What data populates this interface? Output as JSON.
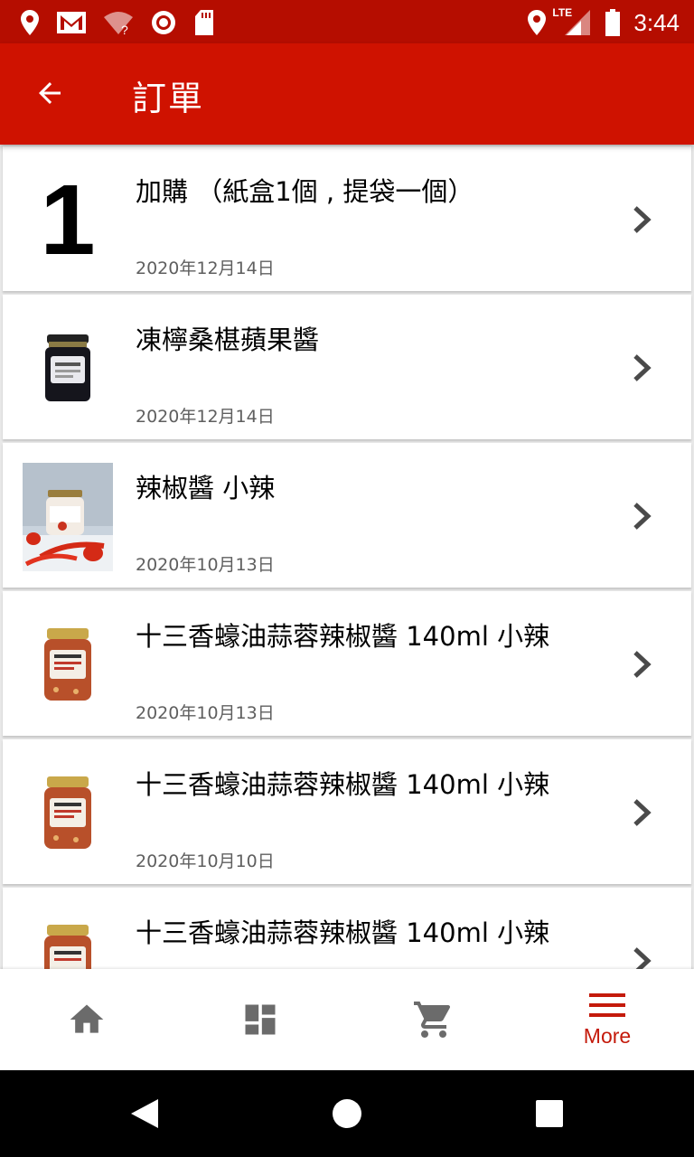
{
  "status_bar": {
    "time": "3:44",
    "network_label": "LTE",
    "icons": [
      "location-pin-icon",
      "gmail-icon",
      "wifi-question-icon",
      "record-icon",
      "sd-card-icon",
      "location-pin-icon",
      "lte-signal-icon",
      "battery-icon"
    ]
  },
  "app_bar": {
    "title": "訂單",
    "back_icon": "arrow-back-icon"
  },
  "orders": [
    {
      "title": "加購 （紙盒1個 , 提袋一個）",
      "date": "2020年12月14日",
      "thumb_text": "1"
    },
    {
      "title": "凍檸桑椹蘋果醬",
      "date": "2020年12月14日",
      "thumb": "jam-jar-image"
    },
    {
      "title": "辣椒醬 小辣",
      "date": "2020年10月13日",
      "thumb": "chili-sauce-photo"
    },
    {
      "title": "十三香蠔油蒜蓉辣椒醬 140ml 小辣",
      "date": "2020年10月13日",
      "thumb": "sauce-jar-image"
    },
    {
      "title": "十三香蠔油蒜蓉辣椒醬 140ml 小辣",
      "date": "2020年10月10日",
      "thumb": "sauce-jar-image"
    },
    {
      "title": "十三香蠔油蒜蓉辣椒醬 140ml 小辣",
      "date": "",
      "thumb": "sauce-jar-image"
    }
  ],
  "bottom_nav": {
    "items": [
      {
        "icon": "home-icon",
        "label": ""
      },
      {
        "icon": "dashboard-icon",
        "label": ""
      },
      {
        "icon": "cart-icon",
        "label": ""
      },
      {
        "icon": "menu-icon",
        "label": "More",
        "active": true
      }
    ]
  },
  "colors": {
    "status_bar": "#b50d00",
    "app_bar": "#cf1200",
    "accent": "#c41a0b",
    "inactive_icon": "#6b6b6b"
  }
}
